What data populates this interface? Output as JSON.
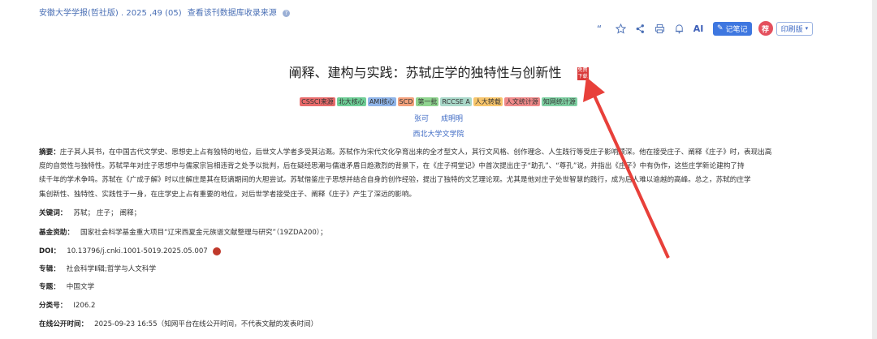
{
  "source": {
    "journal": "安徽大学学报(哲社版)",
    "issue": "2025 ,49 (05)",
    "db_link": "查看该刊数据库收录来源"
  },
  "toolbar": {
    "ai_label": "AI",
    "note_label": "记笔记",
    "rec_label": "荐",
    "print_label": "印刷版"
  },
  "article": {
    "title": "阐释、建构与实践：苏轼庄学的独特性与创新性",
    "title_badge": "免费下载",
    "tags": [
      {
        "label": "CSSCI来源",
        "color": "#e86b6b"
      },
      {
        "label": "北大核心",
        "color": "#6fcf97"
      },
      {
        "label": "AMI核心",
        "color": "#8fb4e8"
      },
      {
        "label": "SCD",
        "color": "#f2a07b"
      },
      {
        "label": "第一批",
        "color": "#8fd48f"
      },
      {
        "label": "RCCSE A",
        "color": "#a9d8c9"
      },
      {
        "label": "人大转载",
        "color": "#f7c56b"
      },
      {
        "label": "人文统计源",
        "color": "#f08a8a"
      },
      {
        "label": "知网统计源",
        "color": "#7fd1a3"
      }
    ],
    "authors": [
      "张可",
      "成明明"
    ],
    "affiliation": "西北大学文学院"
  },
  "abstract": {
    "label": "摘要：",
    "lines": [
      "庄子其人其书，在中国古代文学史、思想史上占有独特的地位，后世文人学者多受其沾溉。苏轼作为宋代文化孕育出来的全才型文人，其行文风格、创作理念、人生践行等受庄子影响颇深。他在接受庄子、阐释《庄子》时，表现出高",
      "度的自觉性与独特性。苏轼早年对庄子思想中与儒家宗旨相违背之处予以批判，后在疑经思潮与儒道矛盾日趋激烈的背景下，在《庄子祠堂记》中首次提出庄子“助孔”、“尊孔”说，并指出《庄子》中有伪作，这些庄学新论建构了持",
      "续千年的学术争鸣。苏轼在《广成子解》时以庄解庄是其在贬谪期间的大胆尝试。苏轼借鉴庄子思想并结合自身的创作经验，提出了独特的文艺理论观。尤其是他对庄子处世智慧的践行，成为后人难以逾越的高峰。总之，苏轼的庄学",
      "集创新性、独特性、实践性于一身，在庄学史上占有重要的地位，对后世学者接受庄子、阐释《庄子》产生了深远的影响。"
    ]
  },
  "fields": [
    {
      "label": "关键词：",
      "value": "苏轼；  庄子；  阐释；"
    },
    {
      "label": "基金资助：",
      "value": "国家社会科学基金重大项目“辽宋西夏金元族谱文献整理与研究”（19ZDA200）；"
    },
    {
      "label": "DOI：",
      "value": "10.13796/j.cnki.1001-5019.2025.05.007"
    },
    {
      "label": "专辑：",
      "value": "社会科学Ⅱ辑;哲学与人文科学"
    },
    {
      "label": "专题：",
      "value": "中国文学"
    },
    {
      "label": "分类号：",
      "value": "I206.2"
    },
    {
      "label": "在线公开时间：",
      "value": "2025-09-23 16:55（知网平台在线公开时间，不代表文献的发表时间）"
    }
  ]
}
